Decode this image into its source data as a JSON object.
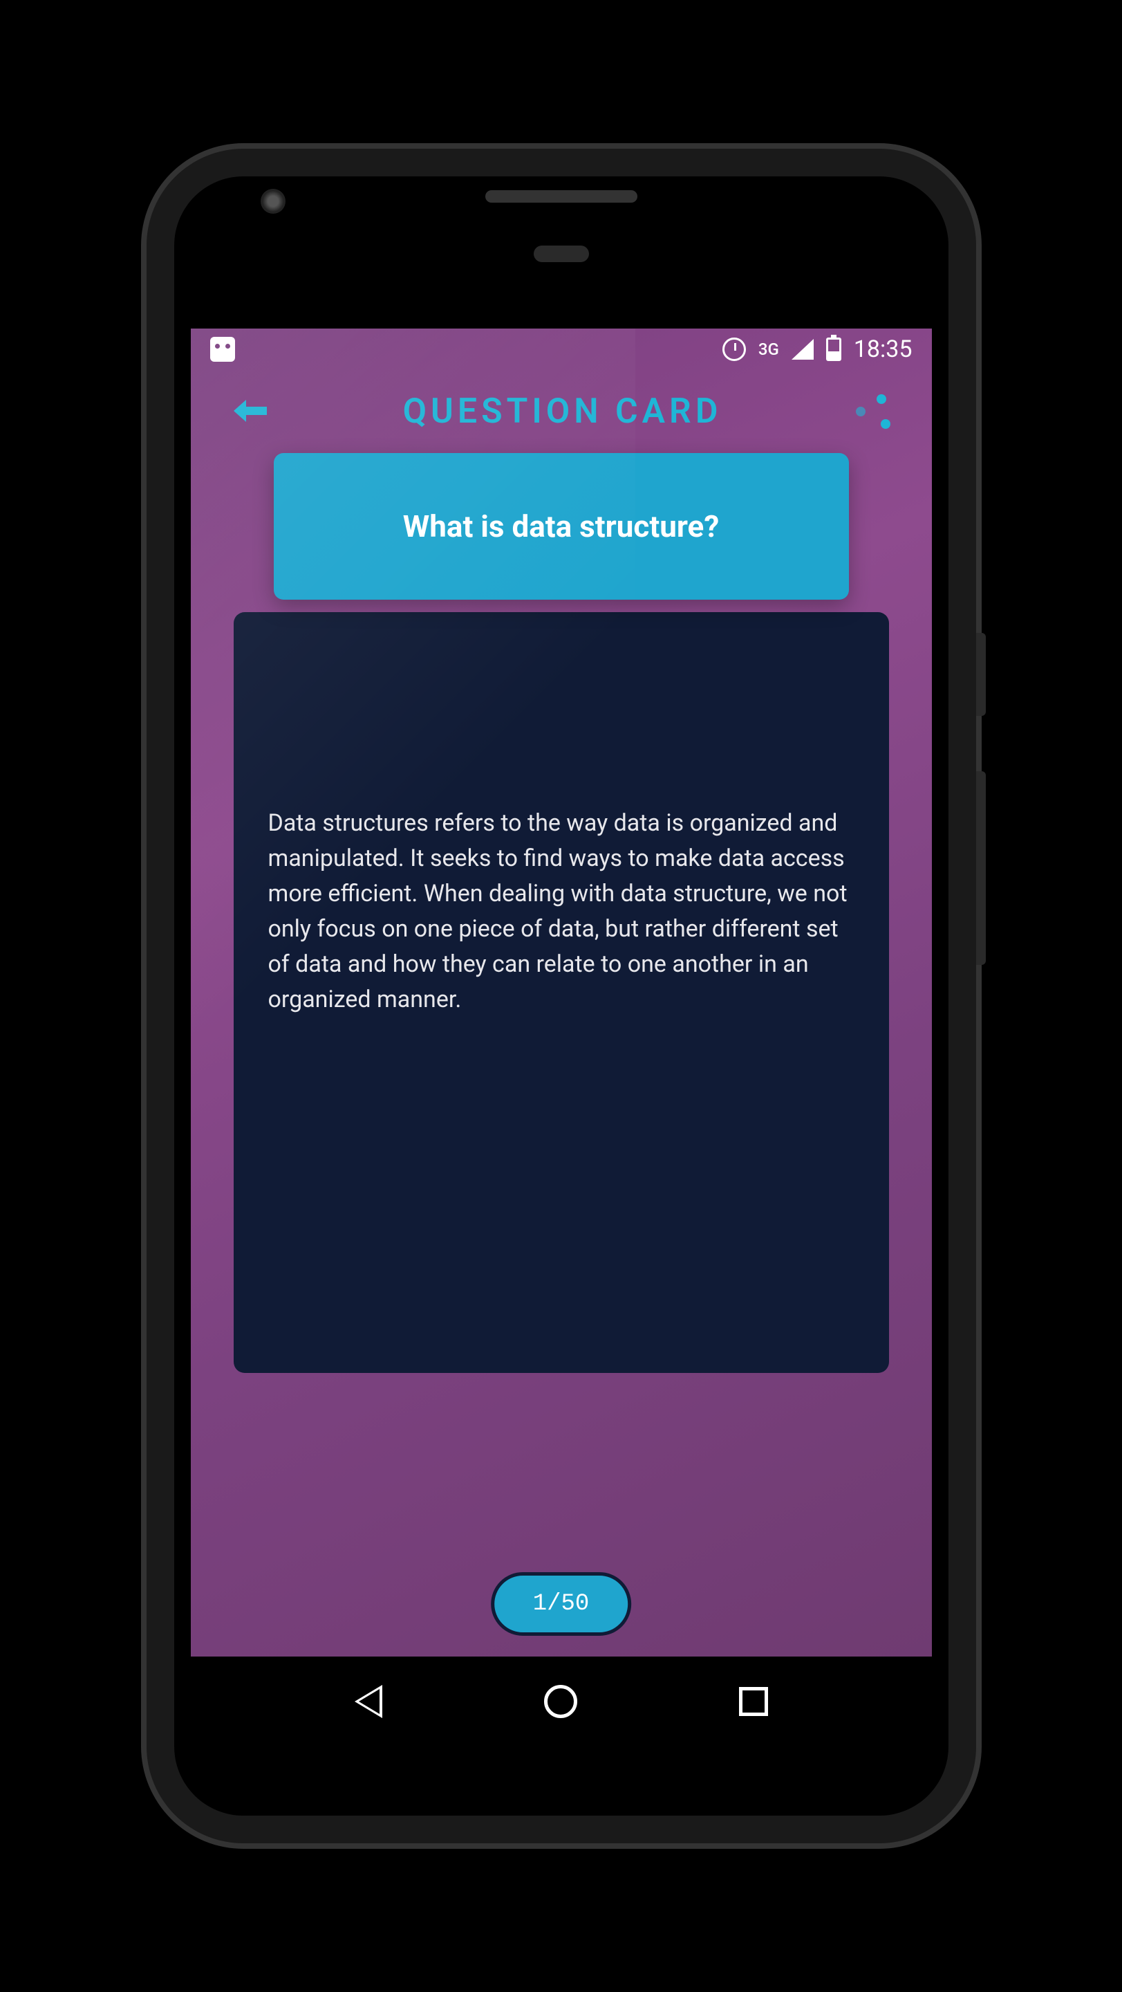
{
  "status": {
    "network": "3G",
    "time": "18:35"
  },
  "header": {
    "title": "Question Card"
  },
  "card": {
    "question": "What is data structure?",
    "answer": "Data structures refers to the way data is organized and manipulated. It seeks to find ways to make data access more efficient. When dealing with data structure, we not only focus on one piece of data, but rather different set of data and how they can relate to one another in an organized manner."
  },
  "pagination": {
    "label": "1/50"
  }
}
